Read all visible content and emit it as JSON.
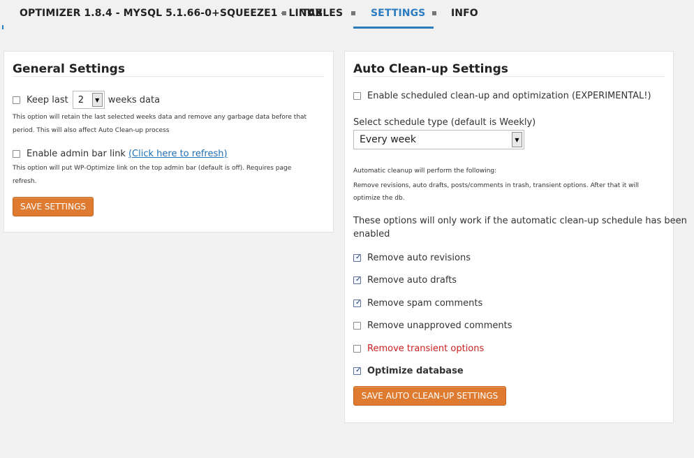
{
  "nav": {
    "title": "OPTIMIZER 1.8.4 - MYSQL 5.1.66-0+SQUEEZE1 - LINUX",
    "tabs": [
      {
        "label": "TABLES"
      },
      {
        "label": "SETTINGS"
      },
      {
        "label": "INFO"
      }
    ],
    "active_tab": "SETTINGS",
    "accent_color": "#2a7bc0"
  },
  "general": {
    "title": "General Settings",
    "keep_last_label": "Keep last",
    "weeks_value": "2",
    "weeks_suffix": "weeks data",
    "keep_help_line1": "This option will retain the last selected weeks data and remove any garbage data before that",
    "keep_help_line2": "period. This will also affect Auto Clean-up process",
    "admin_bar_label": "Enable admin bar link",
    "admin_bar_link": "(Click here to refresh)",
    "admin_help_line1": "This option will put WP-Optimize link on the top admin bar (default is off). Requires page",
    "admin_help_line2": "refresh.",
    "save_label": "SAVE SETTINGS",
    "button_color": "#df7b30"
  },
  "auto": {
    "title": "Auto Clean-up Settings",
    "enable_label": "Enable scheduled clean-up and optimization (EXPERIMENTAL!)",
    "schedule_label": "Select schedule type (default is Weekly)",
    "schedule_value": "Every week",
    "info_line1": "Automatic cleanup will perform the following:",
    "info_line2": "Remove revisions, auto drafts, posts/comments in trash, transient options. After that it will",
    "info_line3": "optimize the db.",
    "note_line1": "These options will only work if the automatic clean-up schedule has been",
    "note_line2": "enabled",
    "options": [
      {
        "label": "Remove auto revisions",
        "checked": true
      },
      {
        "label": "Remove auto drafts",
        "checked": true
      },
      {
        "label": "Remove spam comments",
        "checked": true
      },
      {
        "label": "Remove unapproved comments",
        "checked": false
      },
      {
        "label": "Remove transient options",
        "checked": false
      },
      {
        "label": "Optimize database",
        "checked": true
      }
    ],
    "warning_color": "#cc1f1f",
    "save_label": "SAVE AUTO CLEAN-UP SETTINGS"
  }
}
